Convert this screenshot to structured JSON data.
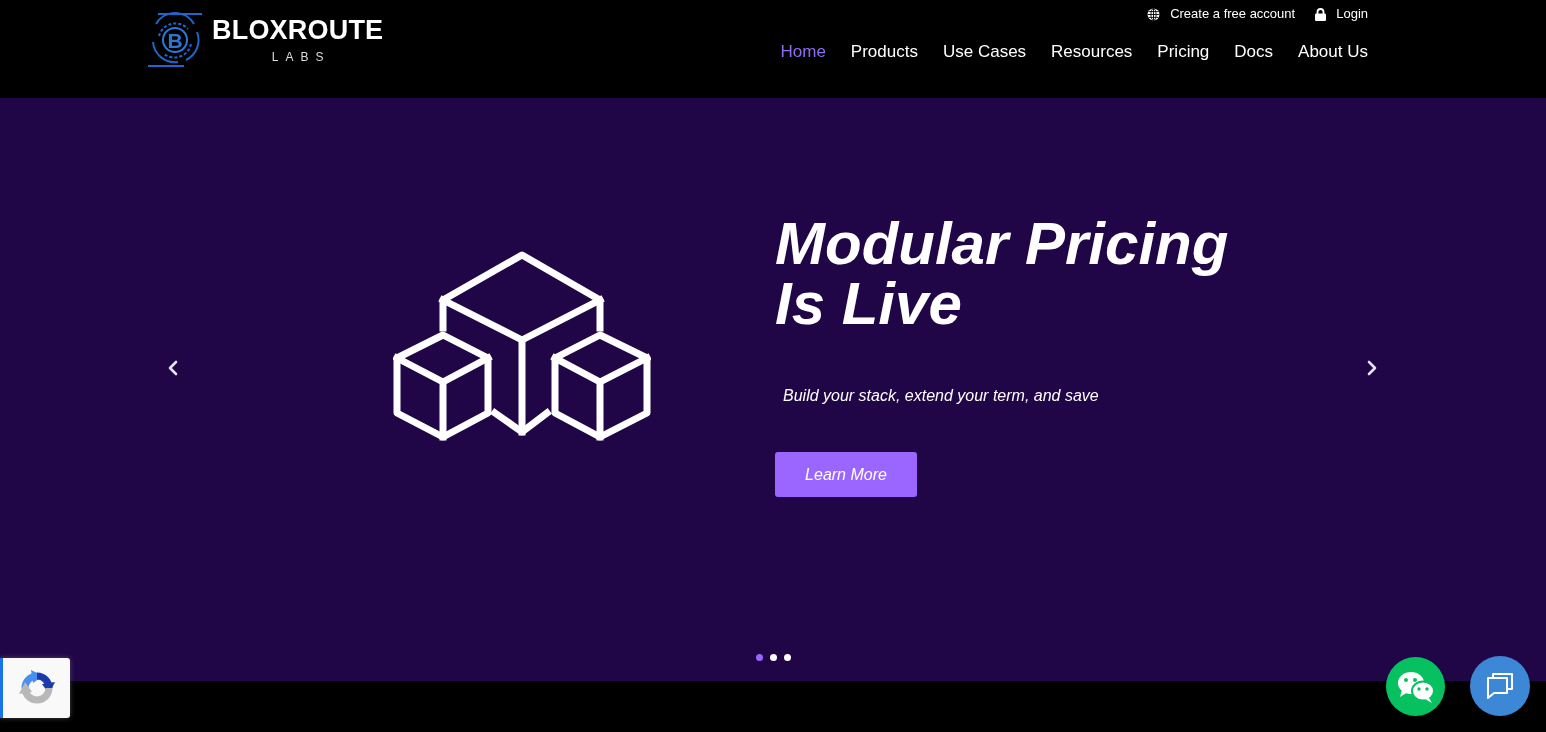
{
  "header": {
    "logo": {
      "mark": "B",
      "name": "BLOXROUTE",
      "tagline": "LABS"
    },
    "top_links": [
      {
        "kind": "globe",
        "label": "Create a free account"
      },
      {
        "kind": "lock",
        "label": "Login"
      }
    ],
    "nav": [
      {
        "label": "Home",
        "selected": true
      },
      {
        "label": "Products",
        "selected": false
      },
      {
        "label": "Use Cases",
        "selected": false
      },
      {
        "label": "Resources",
        "selected": false
      },
      {
        "label": "Pricing",
        "selected": false
      },
      {
        "label": "Docs",
        "selected": false
      },
      {
        "label": "About Us",
        "selected": false
      }
    ]
  },
  "hero": {
    "title": "Modular Pricing Is Live",
    "subtitle": "Build your stack, extend your term, and save",
    "button": "Learn More",
    "indicators": [
      {
        "selected": true
      },
      {
        "selected": false
      },
      {
        "selected": false
      }
    ]
  }
}
